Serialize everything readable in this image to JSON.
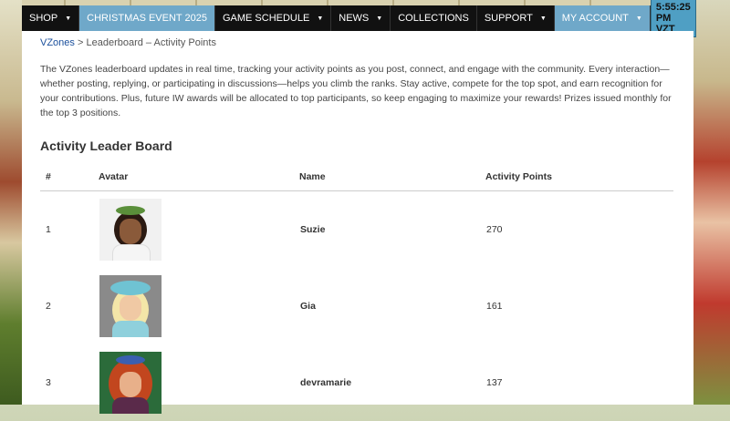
{
  "nav": {
    "items": [
      {
        "label": "SHOP",
        "caret": true,
        "active": false
      },
      {
        "label": "CHRISTMAS EVENT 2025",
        "caret": false,
        "active": true
      },
      {
        "label": "GAME SCHEDULE",
        "caret": true,
        "active": false
      },
      {
        "label": "NEWS",
        "caret": true,
        "active": false
      },
      {
        "label": "COLLECTIONS",
        "caret": false,
        "active": false
      },
      {
        "label": "SUPPORT",
        "caret": true,
        "active": false
      },
      {
        "label": "MY ACCOUNT",
        "caret": true,
        "active": true
      }
    ],
    "clock": "5:55:25 PM VZT"
  },
  "breadcrumb": {
    "home": "VZones",
    "separator": ">",
    "current": "Leaderboard – Activity Points"
  },
  "intro": "The VZones leaderboard updates in real time, tracking your activity points as you post, connect, and engage with the community. Every interaction—whether posting, replying, or participating in discussions—helps you climb the ranks. Stay active, compete for the top spot, and earn recognition for your contributions. Plus, future IW awards will be allocated to top participants, so keep engaging to maximize your rewards! Prizes issued monthly for the top 3 positions.",
  "heading": "Activity Leader Board",
  "table": {
    "headers": {
      "rank": "#",
      "avatar": "Avatar",
      "name": "Name",
      "points": "Activity Points"
    },
    "rows": [
      {
        "rank": "1",
        "name": "Suzie",
        "points": "270"
      },
      {
        "rank": "2",
        "name": "Gia",
        "points": "161"
      },
      {
        "rank": "3",
        "name": "devramarie",
        "points": "137"
      }
    ]
  },
  "colors": {
    "nav_bg": "#111111",
    "nav_active": "#6fa8c9",
    "link": "#1a4f9c",
    "clock_bg": "#4f9fc4"
  }
}
